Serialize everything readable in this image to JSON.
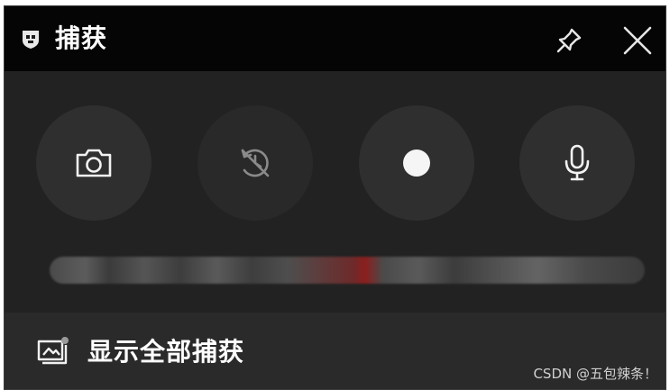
{
  "window": {
    "title": "捕获"
  },
  "titlebar_icons": {
    "app": "game-bar-icon",
    "pin": "pin-icon",
    "close": "close-icon"
  },
  "capture_buttons": [
    {
      "name": "screenshot",
      "icon": "camera-icon",
      "enabled": true
    },
    {
      "name": "record-last-30s",
      "icon": "record-history-icon",
      "enabled": false
    },
    {
      "name": "start-recording",
      "icon": "record-dot-icon",
      "enabled": true
    },
    {
      "name": "microphone",
      "icon": "microphone-icon",
      "enabled": true
    }
  ],
  "footer": {
    "show_all_label": "显示全部捕获",
    "icon": "gallery-icon"
  },
  "watermark": "CSDN @五包辣条！",
  "colors": {
    "titlebar": "#050505",
    "panel": "#222222",
    "button": "#2f2f2f",
    "accent_red": "#8b1e1e"
  }
}
